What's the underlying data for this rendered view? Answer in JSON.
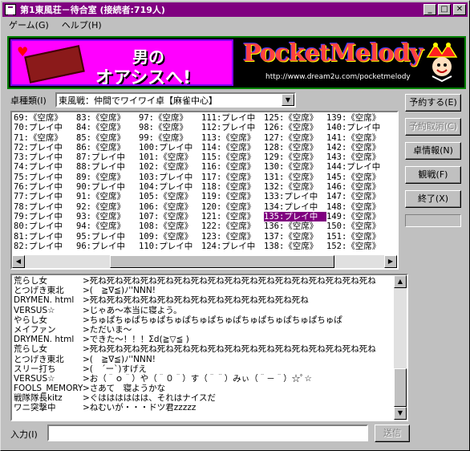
{
  "window": {
    "title": "第1東風荘－待合室 (接続者:719人)"
  },
  "menu": [
    "ゲーム(G)",
    "ヘルプ(H)"
  ],
  "banners": {
    "left_line1": "男の",
    "left_line2": "オアシスへ!",
    "right_title": "PocketMelody",
    "right_url": "http://www.dream2u.com/pocketmelody"
  },
  "table_type": {
    "label": "卓種類(I)",
    "value": "東風戦：仲間でワイワイ卓【麻雀中心】"
  },
  "grid_rows": [
    [
      "69:《空席》",
      "83:《空席》",
      "97:《空席》",
      "111:プレイ中",
      "125:《空席》",
      "139:《空席》"
    ],
    [
      "70:プレイ中",
      "84:《空席》",
      "98:《空席》",
      "112:プレイ中",
      "126:《空席》",
      "140:プレイ中"
    ],
    [
      "71:《空席》",
      "85:《空席》",
      "99:《空席》",
      "113:《空席》",
      "127:《空席》",
      "141:《空席》"
    ],
    [
      "72:プレイ中",
      "86:《空席》",
      "100:プレイ中",
      "114:《空席》",
      "128:《空席》",
      "142:《空席》"
    ],
    [
      "73:プレイ中",
      "87:プレイ中",
      "101:《空席》",
      "115:《空席》",
      "129:《空席》",
      "143:《空席》"
    ],
    [
      "74:プレイ中",
      "88:プレイ中",
      "102:《空席》",
      "116:《空席》",
      "130:《空席》",
      "144:プレイ中"
    ],
    [
      "75:プレイ中",
      "89:《空席》",
      "103:プレイ中",
      "117:《空席》",
      "131:《空席》",
      "145:《空席》"
    ],
    [
      "76:プレイ中",
      "90:プレイ中",
      "104:プレイ中",
      "118:《空席》",
      "132:《空席》",
      "146:《空席》"
    ],
    [
      "77:プレイ中",
      "91:《空席》",
      "105:《空席》",
      "119:《空席》",
      "133:プレイ中",
      "147:《空席》"
    ],
    [
      "78:プレイ中",
      "92:《空席》",
      "106:《空席》",
      "120:《空席》",
      "134:プレイ中",
      "148:《空席》"
    ],
    [
      "79:プレイ中",
      "93:《空席》",
      "107:《空席》",
      "121:《空席》",
      "135:プレイ中",
      "149:《空席》"
    ],
    [
      "80:プレイ中",
      "94:《空席》",
      "108:《空席》",
      "122:《空席》",
      "136:《空席》",
      "150:《空席》"
    ],
    [
      "81:プレイ中",
      "95:プレイ中",
      "109:《空席》",
      "123:《空席》",
      "137:《空席》",
      "151:《空席》"
    ],
    [
      "82:プレイ中",
      "96:プレイ中",
      "110:プレイ中",
      "124:プレイ中",
      "138:《空席》",
      "152:《空席》"
    ]
  ],
  "selected_cell": {
    "row": 10,
    "col": 4
  },
  "buttons": {
    "reserve": "予約する(E)",
    "cancel_reserve": "予約取消(C)",
    "table_info": "卓情報(N)",
    "watch": "観戦(F)",
    "exit": "終了(X)"
  },
  "chat": [
    {
      "nick": "荒らし女",
      "msg": ">死ね死ね死ね死ね死ね死ね死ね死ね死ね死ね死ね死ね死ね死ね死ね死ね死ね"
    },
    {
      "nick": "とつげき東北",
      "msg": ">(　≧∇≦)ﾉ''NNN!"
    },
    {
      "nick": "DRYMEN. html",
      "msg": ">死ね死ね死ね死ね死ね死ね死ね死ね死ね死ね死ね死ね死ね"
    },
    {
      "nick": "VERSUS☆",
      "msg": ">じゃあ～本当に寝よう。"
    },
    {
      "nick": "やらし女",
      "msg": ">ちゅぱちゅぱちゅぱちゅぱちゅぱちゅぱちゅぱちゅぱちゅぱちゅぱ"
    },
    {
      "nick": "メイファン",
      "msg": ">ただいま～"
    },
    {
      "nick": "DRYMEN. html",
      "msg": ">できた～！！！Σd(≧▽≦ )"
    },
    {
      "nick": "荒らし女",
      "msg": ">死ね死ね死ね死ね死ね死ね死ね死ね死ね死ね死ね死ね死ね死ね死ね死ね死ね"
    },
    {
      "nick": "とつげき東北",
      "msg": ">(　≧∇≦)ﾉ''NNN!"
    },
    {
      "nick": "スリー打ち",
      "msg": ">(　´ー`)すげえ"
    },
    {
      "nick": "VERSUS☆",
      "msg": ">お（＾ｏ＾）や（＾０＾）す（＾＾）みぃ（＾－＾）☆ﾟ☆"
    },
    {
      "nick": "FOOLS_MEMORY",
      "msg": ">さあて　寝ようかな"
    },
    {
      "nick": "戦隊隊長kitz",
      "msg": ">ぐはははははは、それはナイスだ"
    },
    {
      "nick": "ワニ突撃中",
      "msg": ">ねむいが・・・ドツ君zzzzz"
    }
  ],
  "input": {
    "label": "入力(I)",
    "value": "",
    "send_label": "送信"
  }
}
